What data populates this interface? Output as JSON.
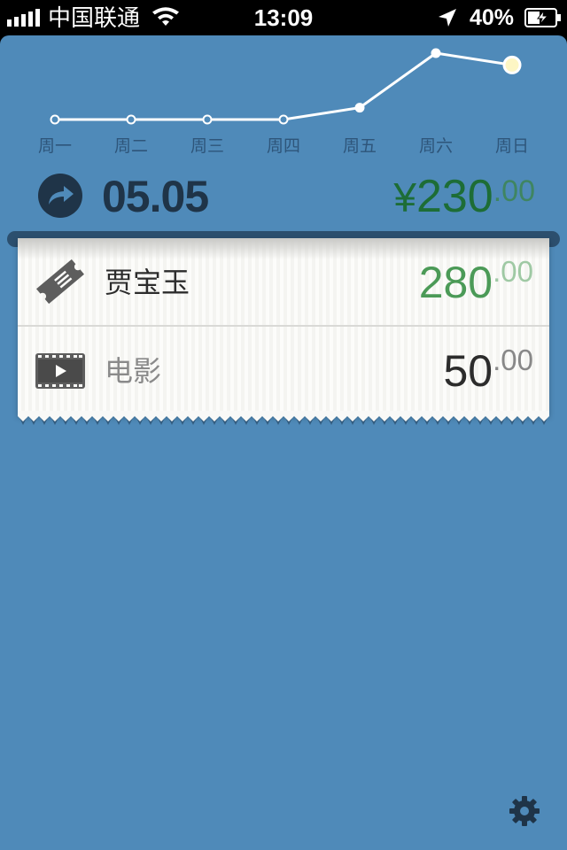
{
  "status_bar": {
    "carrier": "中国联通",
    "time": "13:09",
    "battery": "40%"
  },
  "chart_data": {
    "type": "line",
    "categories": [
      "周一",
      "周二",
      "周三",
      "周四",
      "周五",
      "周六",
      "周日"
    ],
    "series": [
      {
        "values": [
          0,
          0,
          0,
          0,
          50,
          280,
          230
        ]
      }
    ],
    "ylim": [
      0,
      280
    ],
    "highlighted_index": 6
  },
  "summary": {
    "date": "05.05",
    "currency_symbol": "¥",
    "total_int": "230",
    "total_dec": ".00"
  },
  "entries": [
    {
      "icon": "ticket-icon",
      "label": "贾宝玉",
      "amount_int": "280",
      "amount_dec": ".00"
    },
    {
      "icon": "film-icon",
      "label": "电影",
      "amount_int": "50",
      "amount_dec": ".00"
    }
  ],
  "colors": {
    "background": "#4f8ab9",
    "income_green": "#1d6d36",
    "accent_green": "#4b9a57",
    "highlight_dot": "#fdf6c4"
  },
  "icons": {
    "settings": "gear-icon",
    "date": "share-arrow-icon"
  }
}
